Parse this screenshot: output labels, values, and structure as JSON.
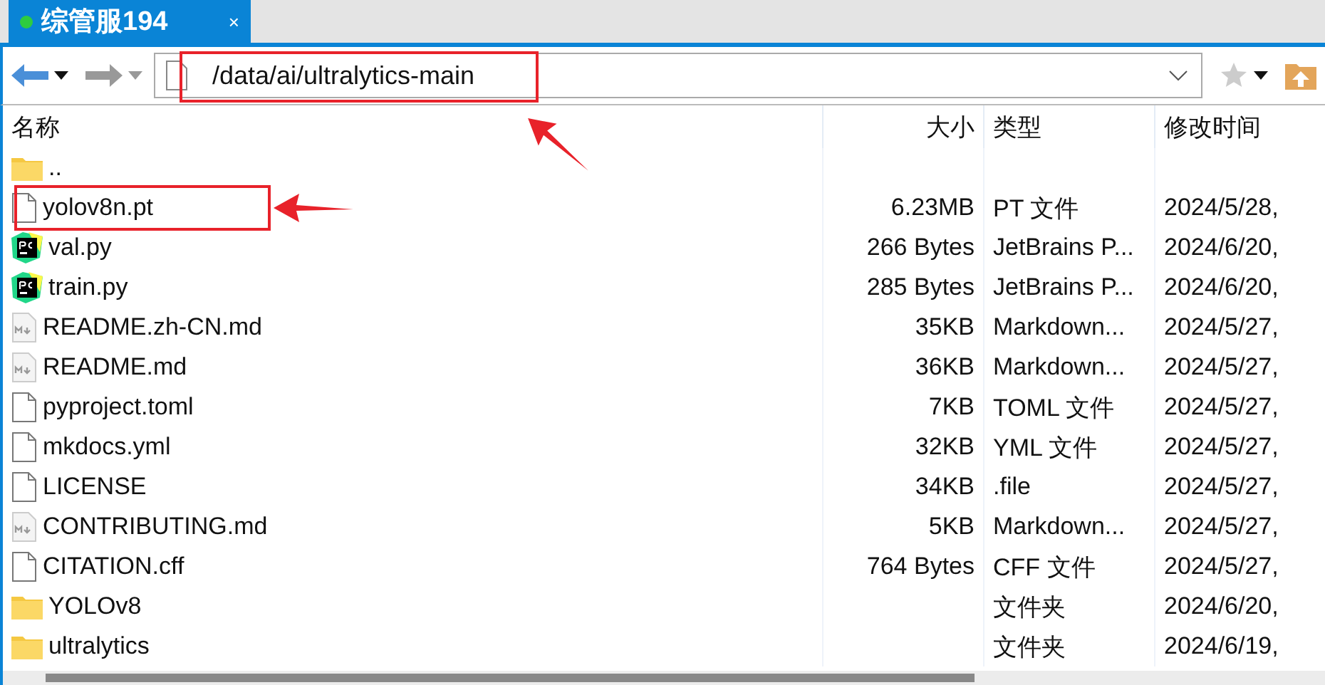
{
  "tab": {
    "title": "综管服194",
    "connected": true,
    "close": "×"
  },
  "address": {
    "value": "/data/ai/ultralytics-main",
    "highlighted": true
  },
  "columns": [
    "名称",
    "大小",
    "类型",
    "修改时间"
  ],
  "rows": [
    {
      "kind": "folder",
      "name": "..",
      "size": "",
      "type": "",
      "modified": "",
      "highlighted": false
    },
    {
      "kind": "file",
      "name": "yolov8n.pt",
      "size": "6.23MB",
      "type": "PT 文件",
      "modified": "2024/5/28,",
      "highlighted": true
    },
    {
      "kind": "pycharm",
      "name": "val.py",
      "size": "266 Bytes",
      "type": "JetBrains P...",
      "modified": "2024/6/20,",
      "highlighted": false
    },
    {
      "kind": "pycharm",
      "name": "train.py",
      "size": "285 Bytes",
      "type": "JetBrains P...",
      "modified": "2024/6/20,",
      "highlighted": false
    },
    {
      "kind": "markdown",
      "name": "README.zh-CN.md",
      "size": "35KB",
      "type": "Markdown...",
      "modified": "2024/5/27,",
      "highlighted": false
    },
    {
      "kind": "markdown",
      "name": "README.md",
      "size": "36KB",
      "type": "Markdown...",
      "modified": "2024/5/27,",
      "highlighted": false
    },
    {
      "kind": "file",
      "name": "pyproject.toml",
      "size": "7KB",
      "type": "TOML 文件",
      "modified": "2024/5/27,",
      "highlighted": false
    },
    {
      "kind": "file",
      "name": "mkdocs.yml",
      "size": "32KB",
      "type": "YML 文件",
      "modified": "2024/5/27,",
      "highlighted": false
    },
    {
      "kind": "file",
      "name": "LICENSE",
      "size": "34KB",
      "type": ".file",
      "modified": "2024/5/27,",
      "highlighted": false
    },
    {
      "kind": "markdown",
      "name": "CONTRIBUTING.md",
      "size": "5KB",
      "type": "Markdown...",
      "modified": "2024/5/27,",
      "highlighted": false
    },
    {
      "kind": "file",
      "name": "CITATION.cff",
      "size": "764 Bytes",
      "type": "CFF 文件",
      "modified": "2024/5/27,",
      "highlighted": false
    },
    {
      "kind": "folder",
      "name": "YOLOv8",
      "size": "",
      "type": "文件夹",
      "modified": "2024/6/20,",
      "highlighted": false
    },
    {
      "kind": "folder",
      "name": "ultralytics",
      "size": "",
      "type": "文件夹",
      "modified": "2024/6/19,",
      "highlighted": false
    }
  ]
}
